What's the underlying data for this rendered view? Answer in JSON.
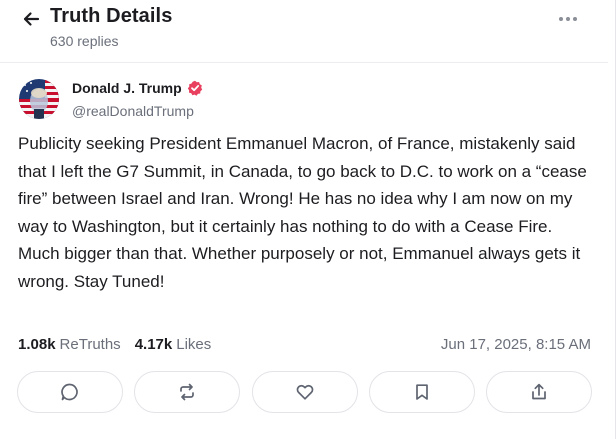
{
  "header": {
    "title": "Truth Details",
    "replies": "630 replies"
  },
  "author": {
    "name": "Donald J. Trump",
    "handle": "@realDonaldTrump"
  },
  "post": {
    "text": "Publicity seeking President Emmanuel Macron, of France, mistakenly said that I left the G7 Summit, in Canada, to go back to D.C. to work on a “cease fire” between Israel and Iran. Wrong! He has no idea why I am now on my way to Washington, but it certainly has nothing to do with a Cease Fire. Much bigger than that. Whether purposely or not, Emmanuel always gets it wrong. Stay Tuned!"
  },
  "stats": {
    "retruths_count": "1.08k",
    "retruths_label": "ReTruths",
    "likes_count": "4.17k",
    "likes_label": "Likes",
    "timestamp": "Jun 17, 2025, 8:15 AM"
  },
  "actions": [
    {
      "icon": "reply-icon"
    },
    {
      "icon": "retruth-icon"
    },
    {
      "icon": "heart-icon"
    },
    {
      "icon": "bookmark-icon"
    },
    {
      "icon": "share-icon"
    }
  ],
  "colors": {
    "verified": "#e8405e",
    "text": "#1d1d21",
    "muted": "#6a6f7a",
    "border": "#e3e3e8"
  }
}
